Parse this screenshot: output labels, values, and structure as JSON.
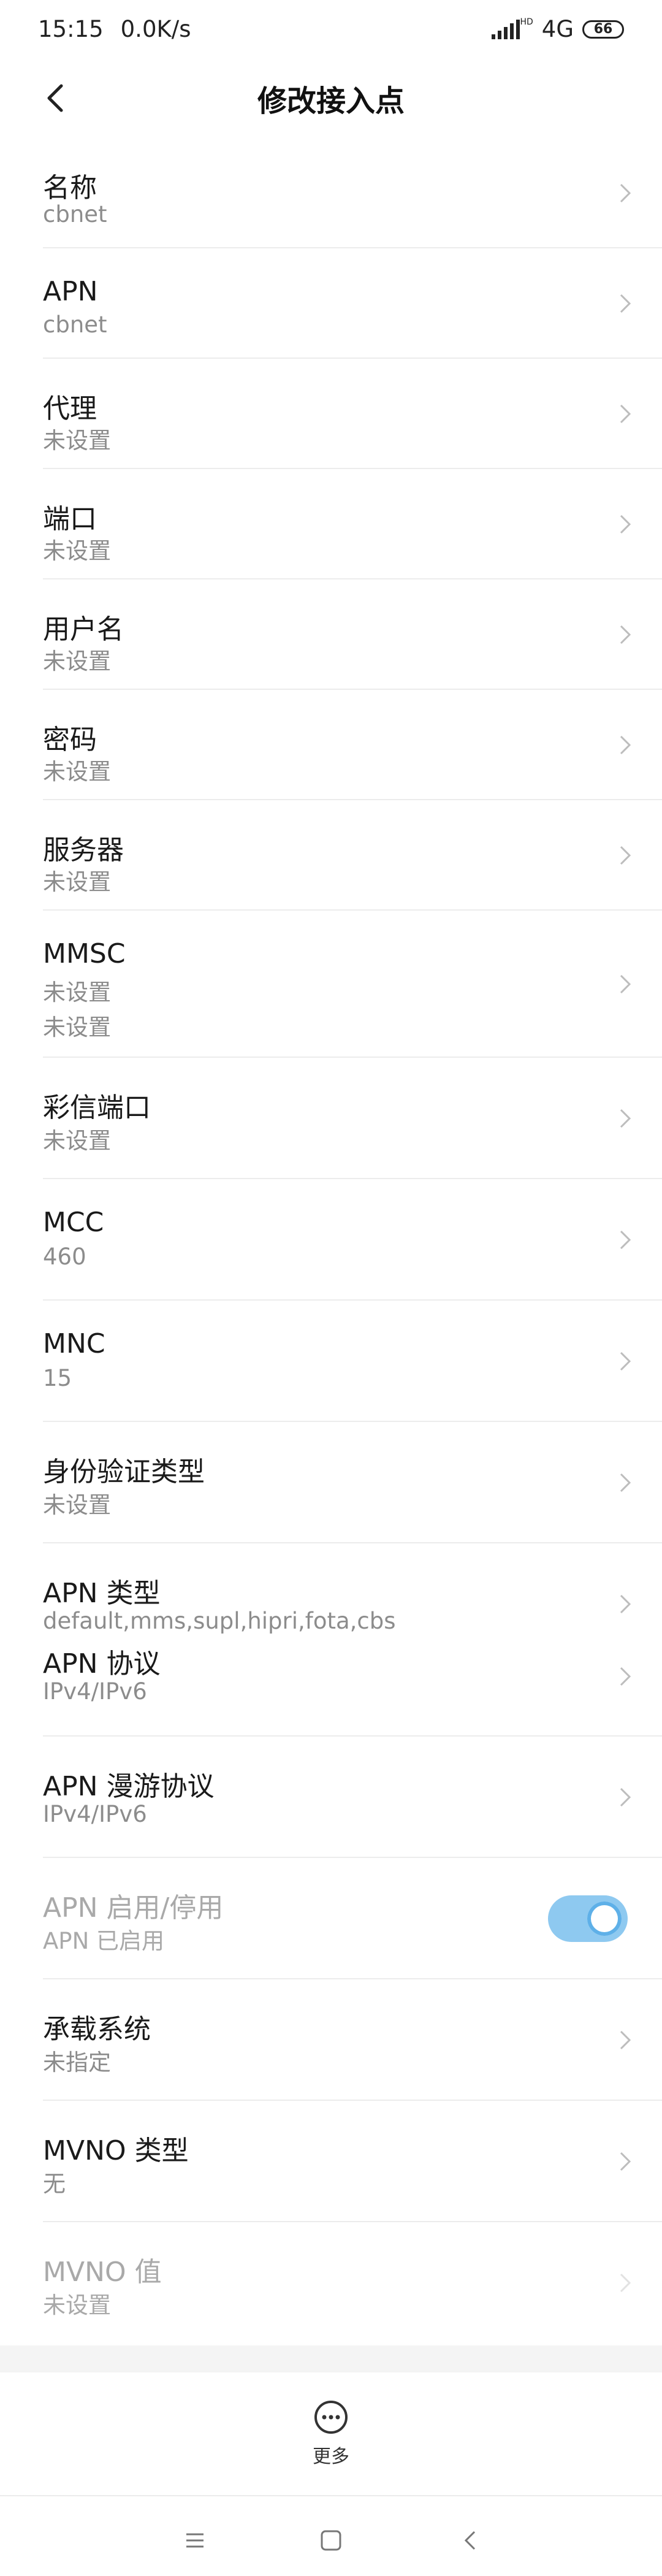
{
  "status": {
    "time": "15:15",
    "speed": "0.0K/s",
    "hd": "HD",
    "network": "4G",
    "battery": "66"
  },
  "header": {
    "title": "修改接入点"
  },
  "rows": [
    {
      "label": "名称",
      "sub": "cbnet"
    },
    {
      "label": "APN",
      "sub": "cbnet"
    },
    {
      "label": "代理",
      "sub": "未设置"
    },
    {
      "label": "端口",
      "sub": "未设置"
    },
    {
      "label": "用户名",
      "sub": "未设置"
    },
    {
      "label": "密码",
      "sub": "未设置"
    },
    {
      "label": "服务器",
      "sub": "未设置"
    },
    {
      "label": "MMSC",
      "sub": "未设置",
      "sub2": "未设置"
    },
    {
      "label": "彩信端口",
      "sub": "未设置"
    },
    {
      "label": "MCC",
      "sub": "460"
    },
    {
      "label": "MNC",
      "sub": "15"
    },
    {
      "label": "身份验证类型",
      "sub": "未设置"
    },
    {
      "label": "APN 类型",
      "sub": "default,mms,supl,hipri,fota,cbs",
      "label2": "APN 协议",
      "sub2": "IPv4/IPv6"
    },
    {
      "label": "APN 漫游协议",
      "sub": "IPv4/IPv6"
    },
    {
      "label": "APN 启用/停用",
      "sub": "APN 已启用",
      "toggle_on": true
    },
    {
      "label": "承载系统",
      "sub": "未指定"
    },
    {
      "label": "MVNO 类型",
      "sub": "无"
    },
    {
      "label": "MVNO 值",
      "sub": "未设置"
    }
  ],
  "footer": {
    "more_label": "更多"
  },
  "colors": {
    "toggle_track": "#8ec9f0",
    "toggle_knob_ring": "#5eb0e8",
    "separator": "#ececec"
  },
  "icons": {
    "back": "back-arrow-icon",
    "chevron": "chevron-right-icon",
    "more": "more-dots-icon"
  }
}
